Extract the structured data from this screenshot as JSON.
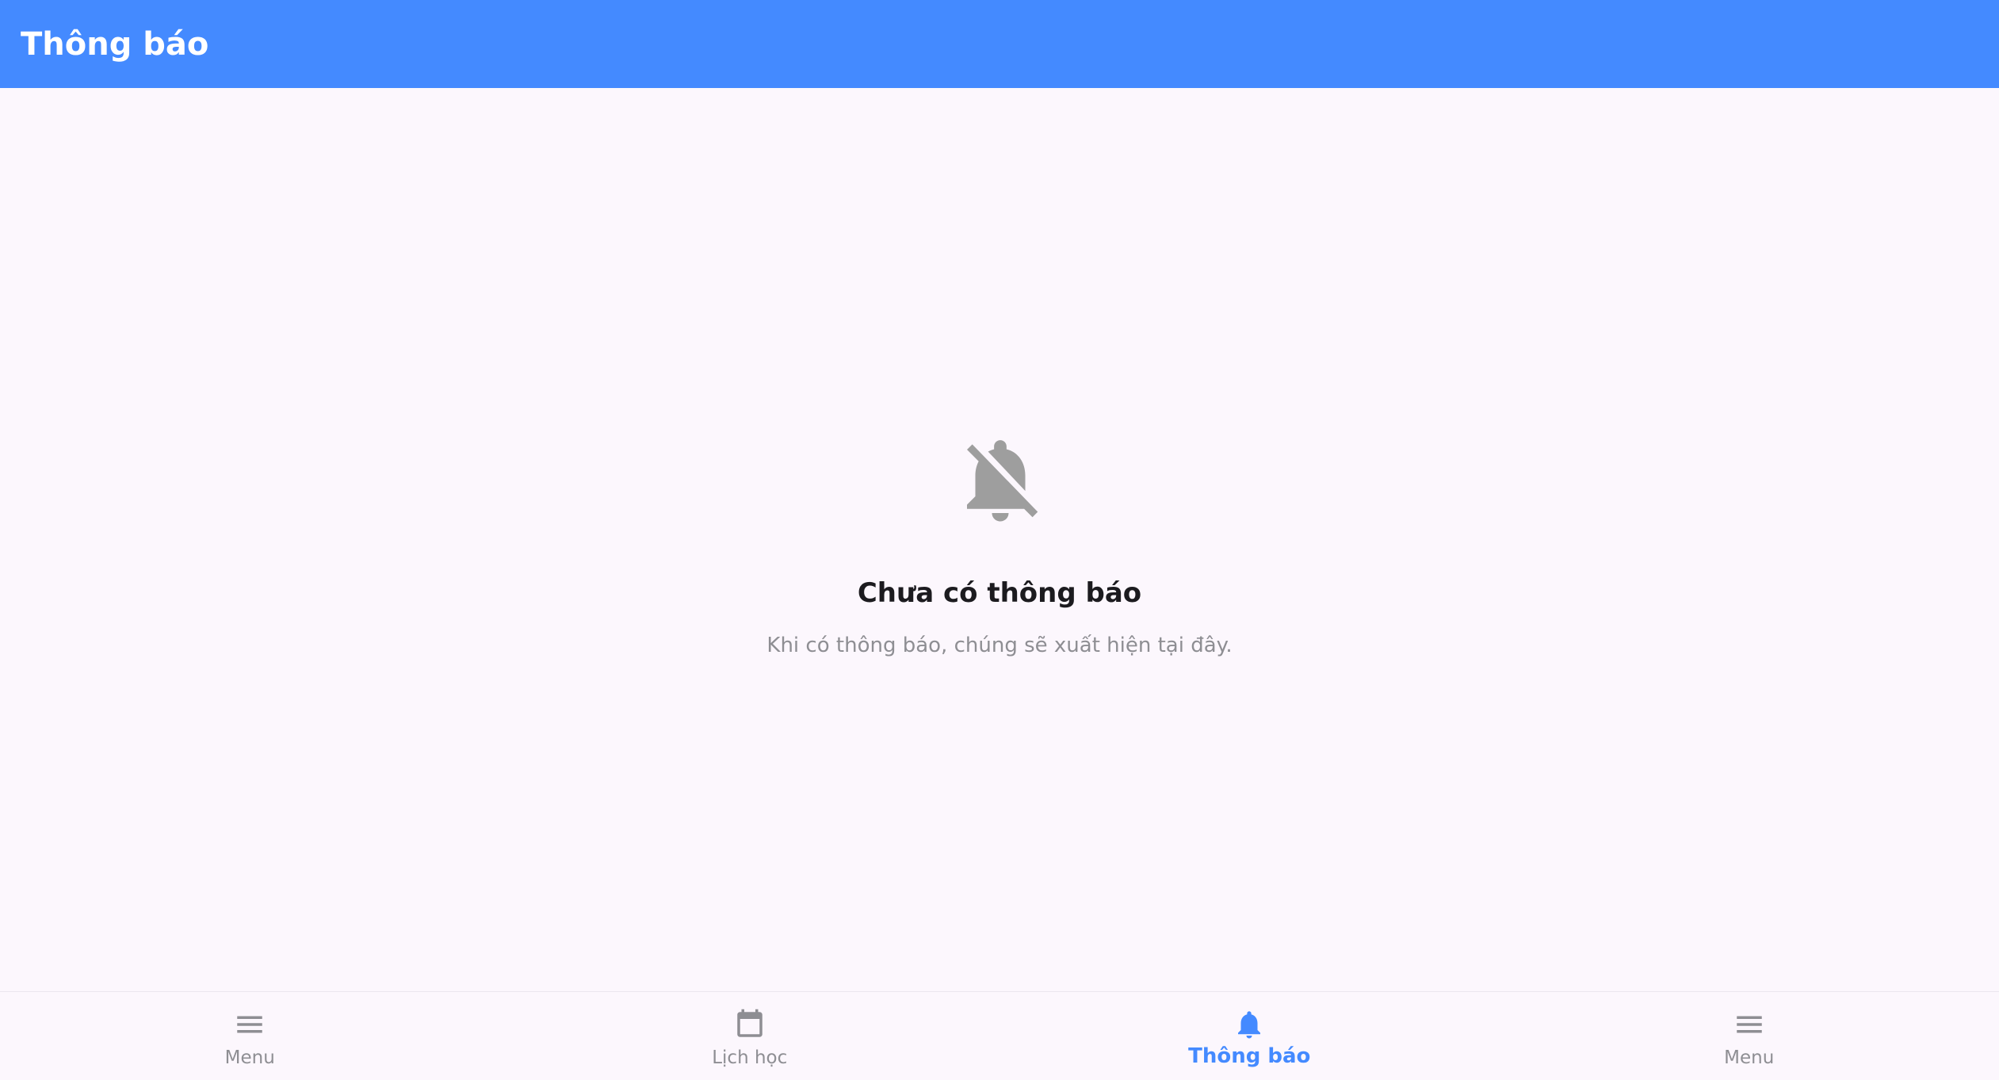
{
  "app_bar": {
    "title": "Thông báo",
    "background": "#448aff"
  },
  "empty_state": {
    "icon": "notifications-off-icon",
    "title": "Chưa có thông báo",
    "subtitle": "Khi có thông báo, chúng sẽ xuất hiện tại đây."
  },
  "bottom_nav": {
    "active_color": "#448aff",
    "inactive_color": "#8e8e93",
    "items": [
      {
        "label": "Menu",
        "icon": "menu-icon",
        "active": false
      },
      {
        "label": "Lịch học",
        "icon": "calendar-icon",
        "active": false
      },
      {
        "label": "Thông báo",
        "icon": "bell-icon",
        "active": true
      },
      {
        "label": "Menu",
        "icon": "menu-icon",
        "active": false
      }
    ]
  }
}
